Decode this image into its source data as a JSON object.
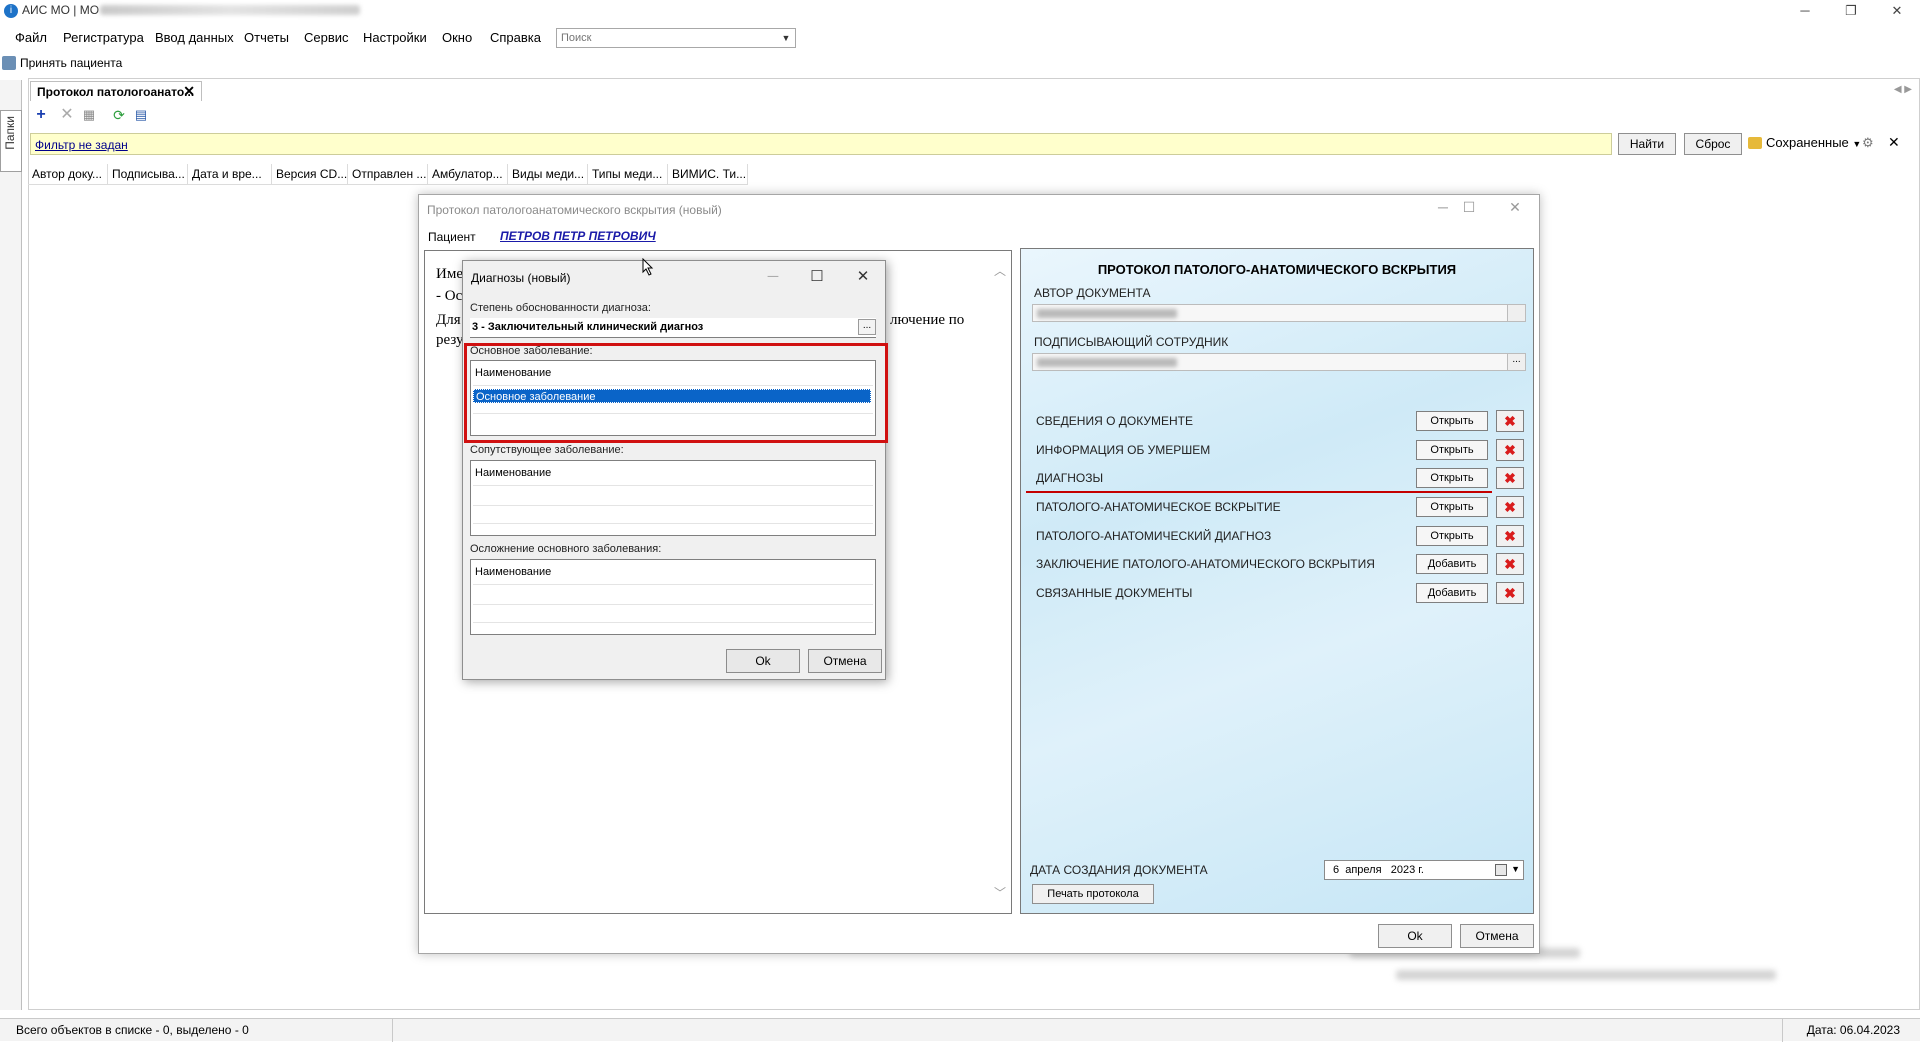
{
  "window": {
    "title": "АИС МО | МО",
    "controls": {
      "minimize": "─",
      "restore": "❐",
      "close": "✕"
    }
  },
  "menu": [
    "Файл",
    "Регистратура",
    "Ввод данных",
    "Отчеты",
    "Сервис",
    "Настройки",
    "Окно",
    "Справка"
  ],
  "search": {
    "placeholder": "Поиск"
  },
  "accept_patient": "Принять пациента",
  "side_panel_label": "Папки",
  "tab": {
    "label": "Протокол патологоанато...",
    "close": "✕"
  },
  "filter": {
    "text": "Фильтр не задан",
    "find": "Найти",
    "reset": "Сброс",
    "saved": "Сохраненные",
    "close": "✕"
  },
  "columns": [
    "Автор доку...",
    "Подписыва...",
    "Дата и вре...",
    "Версия CD...",
    "Отправлен ...",
    "Амбулатор...",
    "Виды меди...",
    "Типы меди...",
    "ВИМИС. Ти..."
  ],
  "status": {
    "left": "Всего объектов в списке - 0, выделено - 0",
    "right": "Дата: 06.04.2023"
  },
  "protocol": {
    "title": "Протокол патологоанатомического вскрытия (новый)",
    "patient_label": "Пациент",
    "patient_name": "ПЕТРОВ ПЕТР ПЕТРОВИЧ",
    "doc_lines": [
      "Име",
      "- Ос",
      "Для",
      "резу",
      "лючение по"
    ],
    "heading": "ПРОТОКОЛ ПАТОЛОГО-АНАТОМИЧЕСКОГО ВСКРЫТИЯ",
    "author_label": "АВТОР ДОКУМЕНТА",
    "signer_label": "ПОДПИСЫВАЮЩИЙ СОТРУДНИК",
    "sections": [
      {
        "label": "СВЕДЕНИЯ О ДОКУМЕНТЕ",
        "action": "Открыть"
      },
      {
        "label": "ИНФОРМАЦИЯ ОБ УМЕРШЕМ",
        "action": "Открыть"
      },
      {
        "label": "ДИАГНОЗЫ",
        "action": "Открыть"
      },
      {
        "label": "ПАТОЛОГО-АНАТОМИЧЕСКОЕ ВСКРЫТИЕ",
        "action": "Открыть"
      },
      {
        "label": "ПАТОЛОГО-АНАТОМИЧЕСКИЙ ДИАГНОЗ",
        "action": "Открыть"
      },
      {
        "label": "ЗАКЛЮЧЕНИЕ ПАТОЛОГО-АНАТОМИЧЕСКОГО ВСКРЫТИЯ",
        "action": "Добавить"
      },
      {
        "label": "СВЯЗАННЫЕ ДОКУМЕНТЫ",
        "action": "Добавить"
      }
    ],
    "date_label": "ДАТА СОЗДАНИЯ ДОКУМЕНТА",
    "date_value": "6  апреля   2023 г.",
    "print": "Печать протокола",
    "ok": "Ok",
    "cancel": "Отмена"
  },
  "diagnoses": {
    "title": "Диагнозы (новый)",
    "degree_label": "Степень обоснованности диагноза:",
    "degree_value": "3 - Заключительный клинический диагноз",
    "main_label": "Основное заболевание:",
    "main_header": "Наименование",
    "main_selected": "Основное заболевание",
    "concomitant_label": "Сопутствующее заболевание:",
    "concomitant_header": "Наименование",
    "complication_label": "Осложнение основного заболевания:",
    "complication_header": "Наименование",
    "ok": "Ok",
    "cancel": "Отмена"
  },
  "colors": {
    "accent_red": "#d01010",
    "selection": "#0a64c8",
    "filter_bg": "#ffffcc",
    "patient_link": "#1a1aa8"
  }
}
